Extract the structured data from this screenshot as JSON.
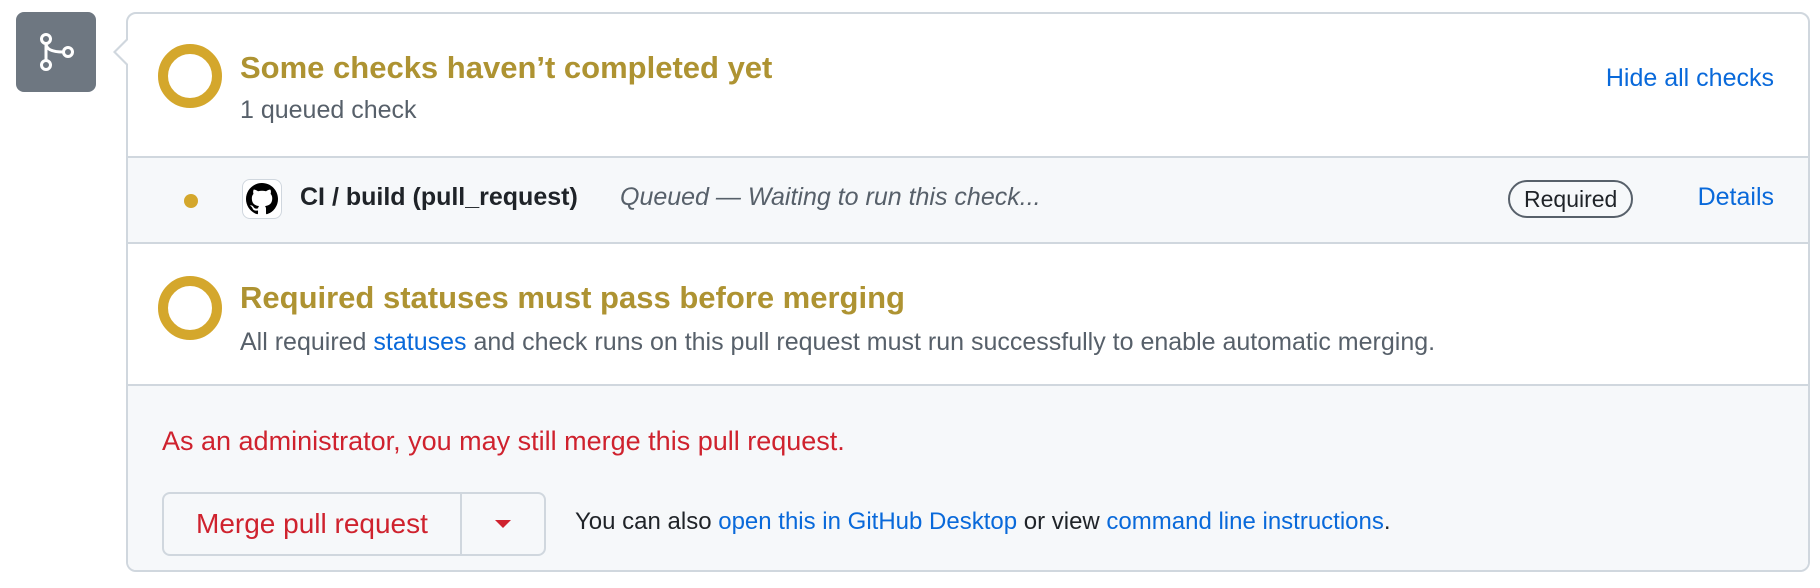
{
  "checks_summary": {
    "title": "Some checks haven’t completed yet",
    "subtitle": "1 queued check",
    "hide_link": "Hide all checks"
  },
  "check_item": {
    "name": "CI / build (pull_request)",
    "status": "Queued — Waiting to run this check...",
    "badge": "Required",
    "details_link": "Details"
  },
  "required_statuses": {
    "title": "Required statuses must pass before merging",
    "text_before": "All required ",
    "link": "statuses",
    "text_after": " and check runs on this pull request must run successfully to enable automatic merging."
  },
  "merge": {
    "admin_note": "As an administrator, you may still merge this pull request.",
    "button_label": "Merge pull request",
    "also_prefix": "You can also ",
    "desktop_link": "open this in GitHub Desktop",
    "middle_text": " or view ",
    "cli_link": "command line instructions",
    "suffix": "."
  },
  "colors": {
    "pending": "#d4a72c",
    "pending_text": "#ae9332",
    "danger": "#cf222e",
    "link": "#0969da",
    "tile_bg": "#6e7781"
  },
  "icons": {
    "branch": "git-branch-icon",
    "ring": "pending-ring-icon",
    "dot": "status-dot-icon",
    "avatar": "github-mark-icon",
    "dropdown": "triangle-down-icon"
  }
}
